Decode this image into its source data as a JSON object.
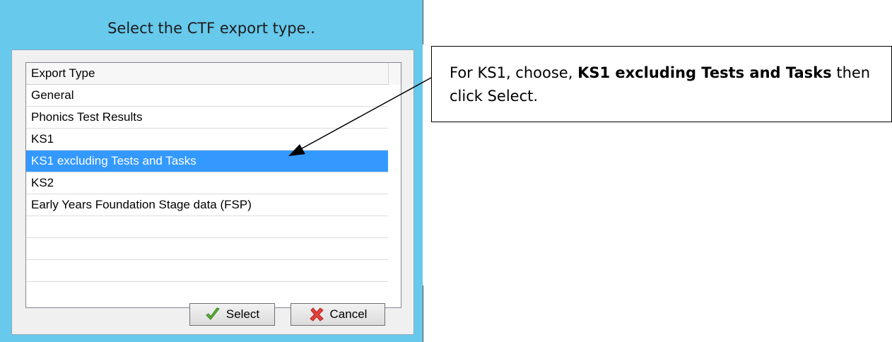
{
  "dialog": {
    "title": "Select the CTF export type..",
    "title_bar_color": "#67c9ec"
  },
  "list": {
    "header": "Export Type",
    "items": [
      "General",
      "Phonics Test Results",
      "KS1",
      "KS1 excluding Tests and Tasks",
      "KS2",
      "Early Years Foundation Stage data (FSP)",
      "",
      "",
      ""
    ],
    "selected_item": "KS1 excluding Tests and Tasks",
    "selection_color": "#3399ff"
  },
  "buttons": {
    "select_label": "Select",
    "select_icon": "checkmark-icon",
    "cancel_label": "Cancel",
    "cancel_icon": "red-x-icon"
  },
  "callout": {
    "text_before": "For KS1, choose, ",
    "text_bold": "KS1 excluding Tests and Tasks",
    "text_after": " then click Select."
  }
}
